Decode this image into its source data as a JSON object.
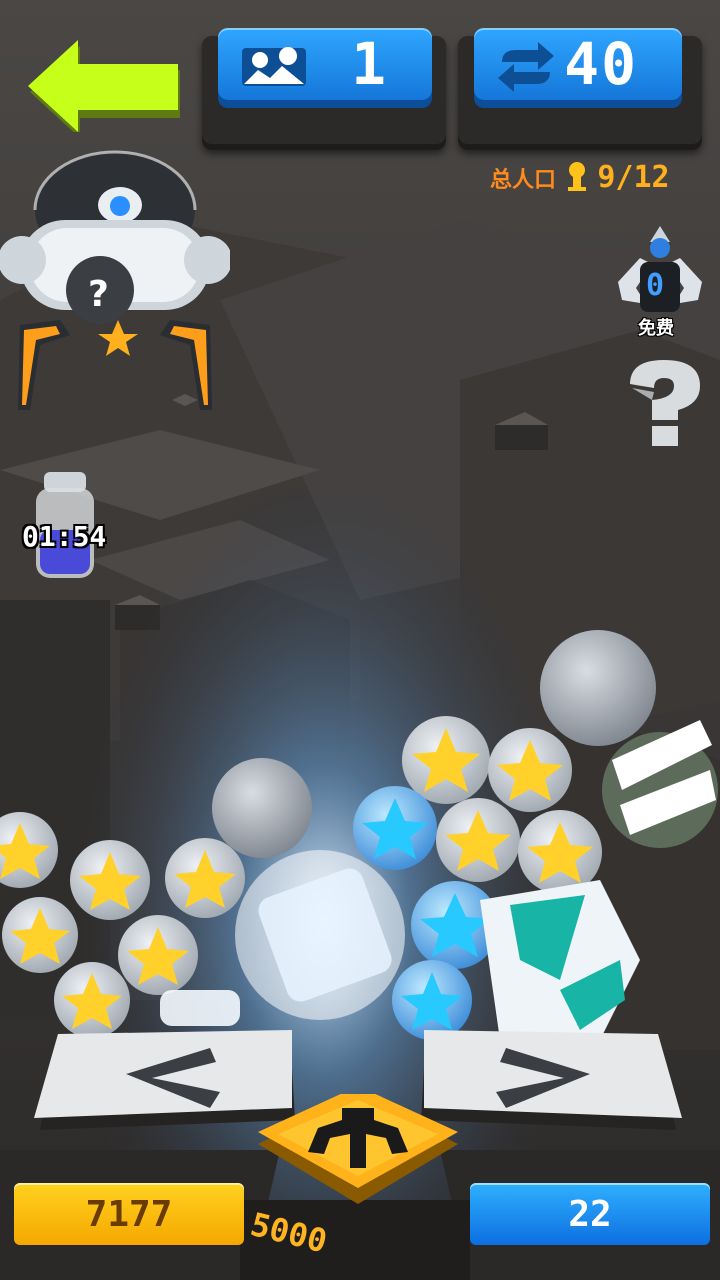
{
  "hud": {
    "stage": {
      "icon": "stage-icon",
      "value": "1"
    },
    "moves": {
      "icon": "swap-arrows-icon",
      "value": "40"
    },
    "population": {
      "label": "总人口",
      "icon": "person-icon",
      "value": "9/12"
    }
  },
  "side": {
    "free_spins": {
      "count": "0",
      "label": "免费"
    },
    "help_icon": "question-icon",
    "timer": "01:54"
  },
  "bottom": {
    "coins": "7177",
    "gems": "22",
    "drop_cost": "5000",
    "drop_icon": "claw-icon"
  },
  "colors": {
    "back_arrow": "#c6ff1a",
    "coin_bar": "#ffc20f",
    "gem_bar": "#1a8cf0",
    "hud_blue": "#1e90f0",
    "population_label": "#ff8a1d"
  }
}
